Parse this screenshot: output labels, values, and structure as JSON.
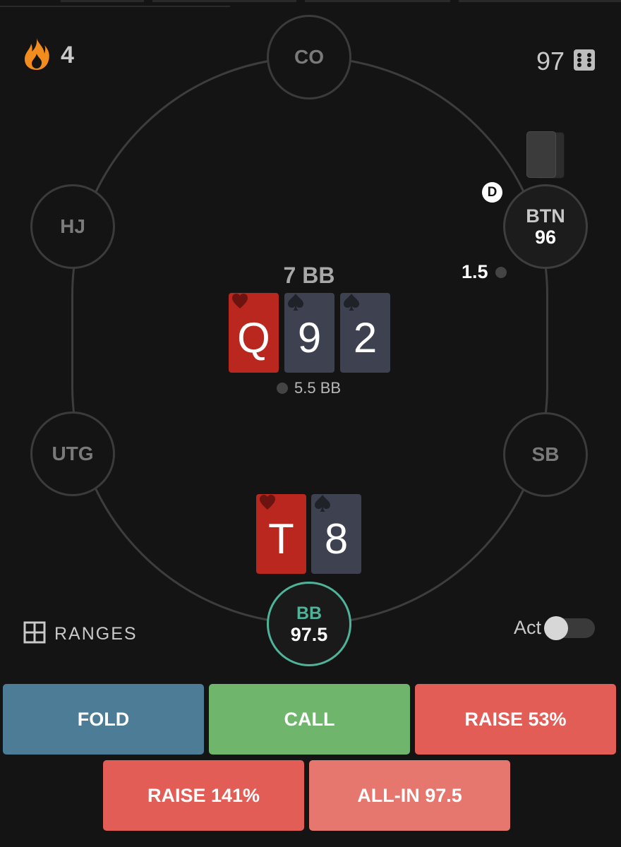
{
  "header": {
    "streak_count": "4",
    "streak_icon": "fire-icon",
    "hands_count": "97",
    "hands_icon": "dice-icon"
  },
  "seats": {
    "co": {
      "label": "CO"
    },
    "hj": {
      "label": "HJ"
    },
    "utg": {
      "label": "UTG"
    },
    "sb": {
      "label": "SB"
    },
    "btn": {
      "label": "BTN",
      "stack": "96",
      "bet": "1.5",
      "dealer_marker": "D"
    },
    "bb": {
      "label": "BB",
      "stack": "97.5"
    }
  },
  "board": {
    "pot_label": "7 BB",
    "cards": [
      {
        "rank": "Q",
        "suit": "hearts",
        "color": "#b9271f"
      },
      {
        "rank": "9",
        "suit": "spades",
        "color": "#3d4150"
      },
      {
        "rank": "2",
        "suit": "spades",
        "color": "#3d4150"
      }
    ],
    "pot_chips_label": "5.5 BB"
  },
  "hero": {
    "cards": [
      {
        "rank": "T",
        "suit": "hearts",
        "color": "#b9271f"
      },
      {
        "rank": "8",
        "suit": "spades",
        "color": "#3d4150"
      }
    ]
  },
  "controls": {
    "ranges_label": "RANGES",
    "act_label": "Act",
    "act_toggle_on": false
  },
  "actions": {
    "fold": "FOLD",
    "call": "CALL",
    "raise_small": "RAISE 53%",
    "raise_big": "RAISE 141%",
    "allin": "ALL-IN 97.5"
  },
  "colors": {
    "background": "#141414",
    "hero_accent": "#4fb39a",
    "fold": "#4c7c96",
    "call": "#6fb56c",
    "raise": "#e35d57",
    "allin": "#e6776f"
  }
}
